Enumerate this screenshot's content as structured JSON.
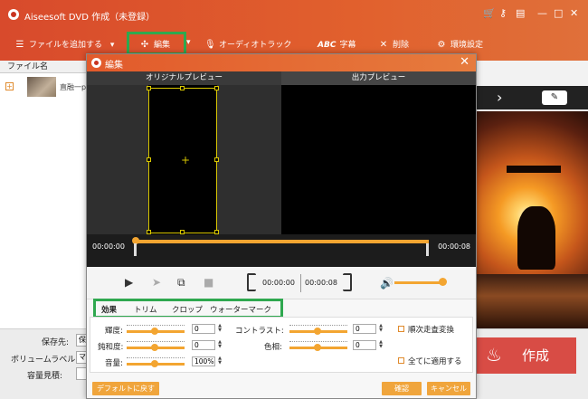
{
  "window": {
    "title": "Aiseesoft DVD 作成（未登録）",
    "min": "—",
    "max": "□",
    "close": "✕"
  },
  "toolbar": {
    "add_file": "ファイルを追加する",
    "edit": "編集",
    "audio_track": "オーディオトラック",
    "subtitle": "字幕",
    "subtitle_prefix": "ABC",
    "delete": "削除",
    "settings": "環境設定"
  },
  "filelist": {
    "header": "ファイル名",
    "items": [
      {
        "name": "直融一p"
      }
    ]
  },
  "bottom": {
    "save_to": "保存先:",
    "save_value": "保",
    "volume_label": "ボリュームラベル:",
    "volume_value": "マ",
    "capacity": "容量見積:",
    "create": "作成"
  },
  "dialog": {
    "title": "編集",
    "close": "✕",
    "original_preview": "オリジナルプレビュー",
    "output_preview": "出力プレビュー",
    "time_start": "00:00:00",
    "time_end": "00:00:08",
    "clip_start": "00:00:00",
    "clip_end": "00:00:08",
    "tabs": [
      "効果",
      "トリム",
      "クロップ",
      "ウォーターマーク"
    ],
    "effects": {
      "brightness": {
        "label": "輝度:",
        "value": "0"
      },
      "saturation": {
        "label": "鈍和度:",
        "value": "0"
      },
      "volume": {
        "label": "音量:",
        "value": "100%"
      },
      "contrast": {
        "label": "コントラスト:",
        "value": "0"
      },
      "hue": {
        "label": "色相:",
        "value": "0"
      },
      "deinterlace": "順次走査変換",
      "apply_all": "全てに適用する"
    },
    "buttons": {
      "default": "デフォルトに戻す",
      "confirm": "確認",
      "cancel": "キャンセル"
    }
  }
}
